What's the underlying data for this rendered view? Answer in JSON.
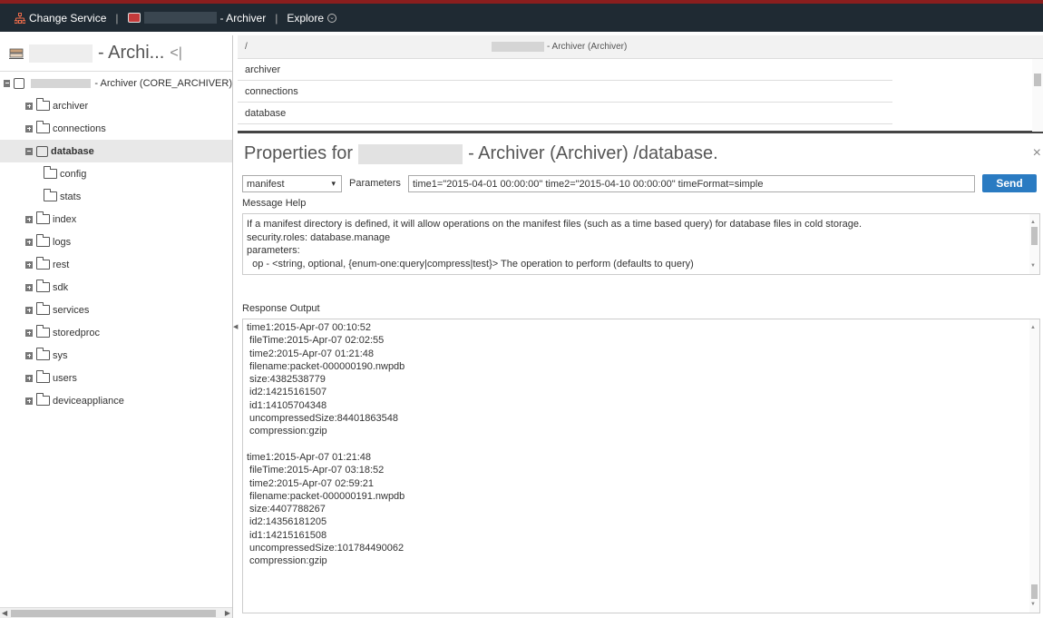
{
  "topbar": {
    "change_service": "Change Service",
    "service_suffix": "- Archiver",
    "explore": "Explore",
    "separator": "|"
  },
  "left": {
    "title": "- Archi...",
    "collapse": "<|",
    "root_suffix": "- Archiver (CORE_ARCHIVER)",
    "items": [
      {
        "label": "archiver"
      },
      {
        "label": "connections"
      },
      {
        "label": "database"
      },
      {
        "label": "config"
      },
      {
        "label": "stats"
      },
      {
        "label": "index"
      },
      {
        "label": "logs"
      },
      {
        "label": "rest"
      },
      {
        "label": "sdk"
      },
      {
        "label": "services"
      },
      {
        "label": "storedproc"
      },
      {
        "label": "sys"
      },
      {
        "label": "users"
      },
      {
        "label": "deviceappliance"
      }
    ]
  },
  "pathtable": {
    "col1": "/",
    "col2_suffix": "- Archiver (Archiver)",
    "rows": [
      "archiver",
      "connections",
      "database"
    ]
  },
  "props": {
    "title_prefix": "Properties for",
    "title_suffix": "- Archiver (Archiver) /database.",
    "close": "×",
    "message_select": "manifest",
    "params_label": "Parameters",
    "params_value": "time1=\"2015-04-01 00:00:00\" time2=\"2015-04-10 00:00:00\" timeFormat=simple",
    "send": "Send",
    "message_help_label": "Message Help",
    "message_help": [
      "If a manifest directory is defined, it will allow operations on the manifest files (such as a time based query) for database files in cold storage.",
      "security.roles: database.manage",
      "parameters:",
      "  op - <string, optional, {enum-one:query|compress|test}> The operation to perform (defaults to query)"
    ],
    "response_label": "Response Output",
    "response_blocks": [
      [
        "time1:2015-Apr-07 00:10:52",
        " fileTime:2015-Apr-07 02:02:55",
        " time2:2015-Apr-07 01:21:48",
        " filename:packet-000000190.nwpdb",
        " size:4382538779",
        " id2:14215161507",
        " id1:14105704348",
        " uncompressedSize:84401863548",
        " compression:gzip"
      ],
      [
        "time1:2015-Apr-07 01:21:48",
        " fileTime:2015-Apr-07 03:18:52",
        " time2:2015-Apr-07 02:59:21",
        " filename:packet-000000191.nwpdb",
        " size:4407788267",
        " id2:14356181205",
        " id1:14215161508",
        " uncompressedSize:101784490062",
        " compression:gzip"
      ]
    ]
  },
  "colors": {
    "topbar_bg": "#1f2a33",
    "topbar_accent": "#8a1e1e",
    "send_button": "#2a7bc2",
    "selected_row": "#e8e8e8"
  }
}
